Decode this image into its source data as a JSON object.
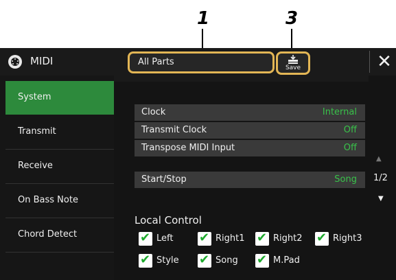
{
  "callouts": {
    "one": "1",
    "three": "3"
  },
  "header": {
    "title": "MIDI",
    "parts_selector": "All Parts",
    "save_label": "Save",
    "close_label": "✕"
  },
  "sidebar": {
    "items": [
      {
        "label": "System",
        "active": true
      },
      {
        "label": "Transmit",
        "active": false
      },
      {
        "label": "Receive",
        "active": false
      },
      {
        "label": "On Bass Note",
        "active": false
      },
      {
        "label": "Chord Detect",
        "active": false
      }
    ]
  },
  "settings": [
    {
      "label": "Clock",
      "value": "Internal"
    },
    {
      "label": "Transmit Clock",
      "value": "Off"
    },
    {
      "label": "Transpose MIDI Input",
      "value": "Off"
    },
    {
      "label": "Start/Stop",
      "value": "Song"
    }
  ],
  "pager": {
    "page": "1/2"
  },
  "local_control": {
    "title": "Local Control",
    "items": [
      {
        "label": "Left",
        "checked": true
      },
      {
        "label": "Right1",
        "checked": true
      },
      {
        "label": "Right2",
        "checked": true
      },
      {
        "label": "Right3",
        "checked": true
      },
      {
        "label": "Style",
        "checked": true
      },
      {
        "label": "Song",
        "checked": true
      },
      {
        "label": "M.Pad",
        "checked": true
      }
    ]
  },
  "colors": {
    "accent": "#2d8a3c",
    "value_green": "#39c24a",
    "highlight": "#e3b655"
  }
}
